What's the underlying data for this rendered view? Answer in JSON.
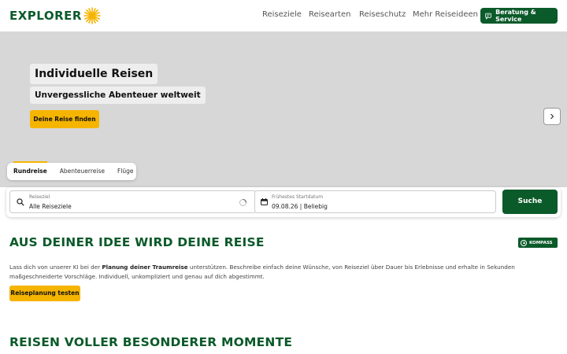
{
  "header": {
    "logo_text": "EXPLORER",
    "nav": [
      "Reiseziele",
      "Reisearten",
      "Reiseschutz",
      "Mehr Reiseideen"
    ],
    "service_button": "Beratung & Service"
  },
  "hero": {
    "title": "Individuelle Reisen",
    "subtitle": "Unvergessliche Abenteuer weltweit",
    "cta": "Deine Reise finden"
  },
  "search": {
    "tabs": [
      "Rundreise",
      "Abenteuerreise",
      "Flüge"
    ],
    "active_tab": "Rundreise",
    "destination_label": "Reiseziel",
    "destination_value": "Alle Reiseziele",
    "date_label": "Frühestes Startdatum",
    "date_value": "09.08.26 | Beliebig",
    "submit": "Suche"
  },
  "section1": {
    "title": "AUS DEINER IDEE WIRD DEINE REISE",
    "badge": "KOMPASS",
    "text_1": "Lass dich von unserer KI bei der ",
    "text_bold": "Planung deiner Traumreise",
    "text_2": " unterstützen. Beschreibe einfach deine Wünsche, von Reiseziel über Dauer bis Erlebnisse und erhalte in Sekunden maßgeschneiderte Vorschläge. Individuell, unkompliziert und genau auf dich abgestimmt.",
    "button": "Reiseplanung testen"
  },
  "section2": {
    "title": "REISEN VOLLER BESONDERER MOMENTE"
  },
  "colors": {
    "brand_green": "#0b5a2a",
    "accent_yellow": "#f5b400",
    "hero_background": "#d7d7d7"
  }
}
